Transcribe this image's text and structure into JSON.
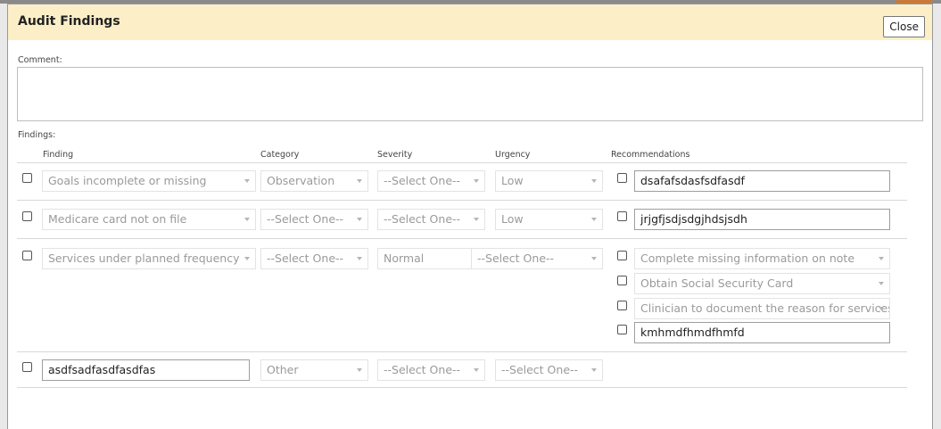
{
  "dialog": {
    "title": "Audit Findings",
    "close_label": "Close"
  },
  "comment": {
    "label": "Comment:",
    "value": ""
  },
  "findings": {
    "label": "Findings:",
    "columns": [
      "Finding",
      "Category",
      "Severity",
      "Urgency",
      "Recommendations"
    ],
    "rows": [
      {
        "finding": "Goals incomplete or missing",
        "category": "Observation",
        "severity": "--Select One--",
        "urgency": "Low",
        "recommendations": [
          {
            "type": "text",
            "value": "dsafafsdasfsdfasdf"
          }
        ]
      },
      {
        "finding": "Medicare card not on file",
        "category": "--Select One--",
        "severity": "--Select One--",
        "urgency": "Low",
        "recommendations": [
          {
            "type": "text",
            "value": "jrjgfjsdjsdgjhdsjsdh"
          }
        ]
      },
      {
        "finding": "Services under planned frequency",
        "category": "--Select One--",
        "severity": "Normal",
        "urgency": "--Select One--",
        "recommendations": [
          {
            "type": "select",
            "value": "Complete missing information on note"
          },
          {
            "type": "select",
            "value": "Obtain Social Security Card"
          },
          {
            "type": "select",
            "value": "Clinician to document the reason for services"
          },
          {
            "type": "text",
            "value": "kmhmdfhmdfhmfd"
          }
        ]
      },
      {
        "finding": "asdfsadfasdfasdfas",
        "finding_type": "text",
        "category": "Other",
        "severity": "--Select One--",
        "urgency": "--Select One--",
        "recommendations": []
      }
    ]
  },
  "colors": {
    "header_bg": "#fcefc7",
    "border": "#9a9a9a",
    "disabled_text": "#9a9a9a"
  }
}
